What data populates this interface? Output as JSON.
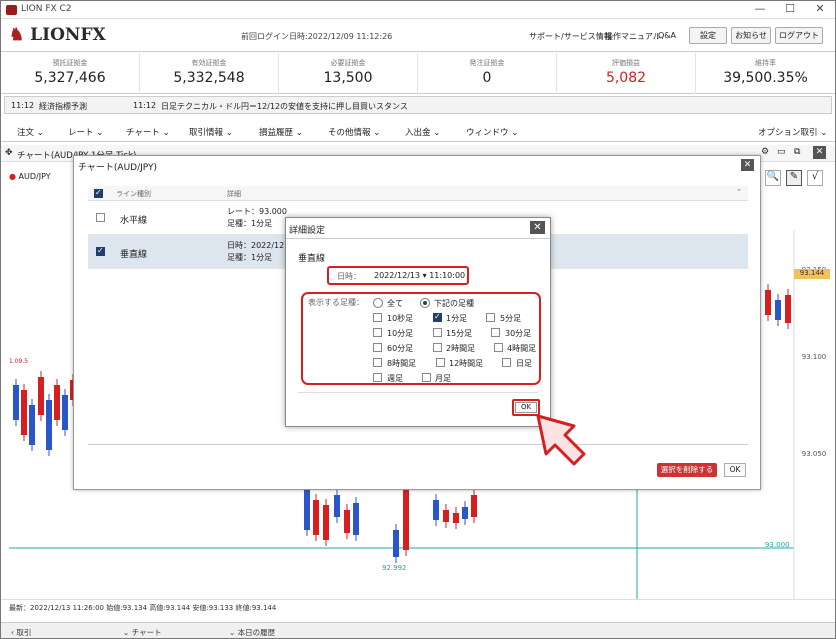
{
  "window": {
    "title": "LION FX C2",
    "min": "—",
    "max": "☐",
    "close": "✕"
  },
  "header": {
    "logo": "LIONFX",
    "last_login": "前回ログイン日時:2022/12/09 11:12:26",
    "links": [
      "サポート/サービス情報",
      "操作マニュアル",
      "Q&A"
    ],
    "buttons": [
      "設定",
      "お知らせ",
      "ログアウト"
    ]
  },
  "summary": [
    {
      "label": "預託証拠金",
      "value": "5,327,466"
    },
    {
      "label": "有効証拠金",
      "value": "5,332,548"
    },
    {
      "label": "必要証拠金",
      "value": "13,500"
    },
    {
      "label": "発注証拠金",
      "value": "0"
    },
    {
      "label": "評価損益",
      "value": "5,082"
    },
    {
      "label": "維持率",
      "value": "39,500.35%"
    }
  ],
  "news": {
    "time1": "11:12",
    "text1": "経済指標予測",
    "time2": "11:12",
    "text2": "日足テクニカル・ドル円＝12/12の安値を支持に押し目買いスタンス"
  },
  "menu": [
    "注文",
    "レート",
    "チャート",
    "取引情報",
    "損益履歴",
    "その他情報",
    "入出金",
    "ウィンドウ"
  ],
  "menu_right": "オプション取引",
  "chart": {
    "title": "チャート(AUD/JPY 1分足 Tick)",
    "symbol": "AUD/JPY",
    "prices": [
      "93.150",
      "93.144",
      "93.100",
      "93.050",
      "93.000"
    ],
    "low_label": "92.992",
    "left_label": "1.09.5",
    "info": "最新：2022/12/13 11:26:00 始値:93.134 高値:93.144 安値:93.133 終値:93.144"
  },
  "colors": {
    "accent": "#d62020",
    "navy": "#223f6b",
    "profit": "#d62020"
  },
  "dialog1": {
    "title": "チャート(AUD/JPY)",
    "col_type": "ライン種別",
    "col_detail": "詳細",
    "rows": [
      {
        "name": "水平線",
        "d1": "レート：93.000",
        "d2": "足種：1分足",
        "checked": false
      },
      {
        "name": "垂直線",
        "d1": "日時：2022/12",
        "d2": "足種：1分足",
        "checked": true
      }
    ],
    "delete_label": "選択を削除する",
    "ok_label": "OK"
  },
  "dialog2": {
    "title": "詳細設定",
    "section": "垂直線",
    "date_label": "日時：",
    "date_value": "2022/12/13 ▾ 11:10:00",
    "tf_label": "表示する足種：",
    "radio_all": "全て",
    "radio_below": "下記の足種",
    "options": [
      "10秒足",
      "1分足",
      "5分足",
      "10分足",
      "15分足",
      "30分足",
      "60分足",
      "2時間足",
      "4時間足",
      "8時間足",
      "12時間足",
      "日足",
      "週足",
      "月足"
    ],
    "ok_label": "OK"
  },
  "footer": {
    "tabs": [
      "取引",
      "チャート",
      "本日の履歴"
    ]
  }
}
